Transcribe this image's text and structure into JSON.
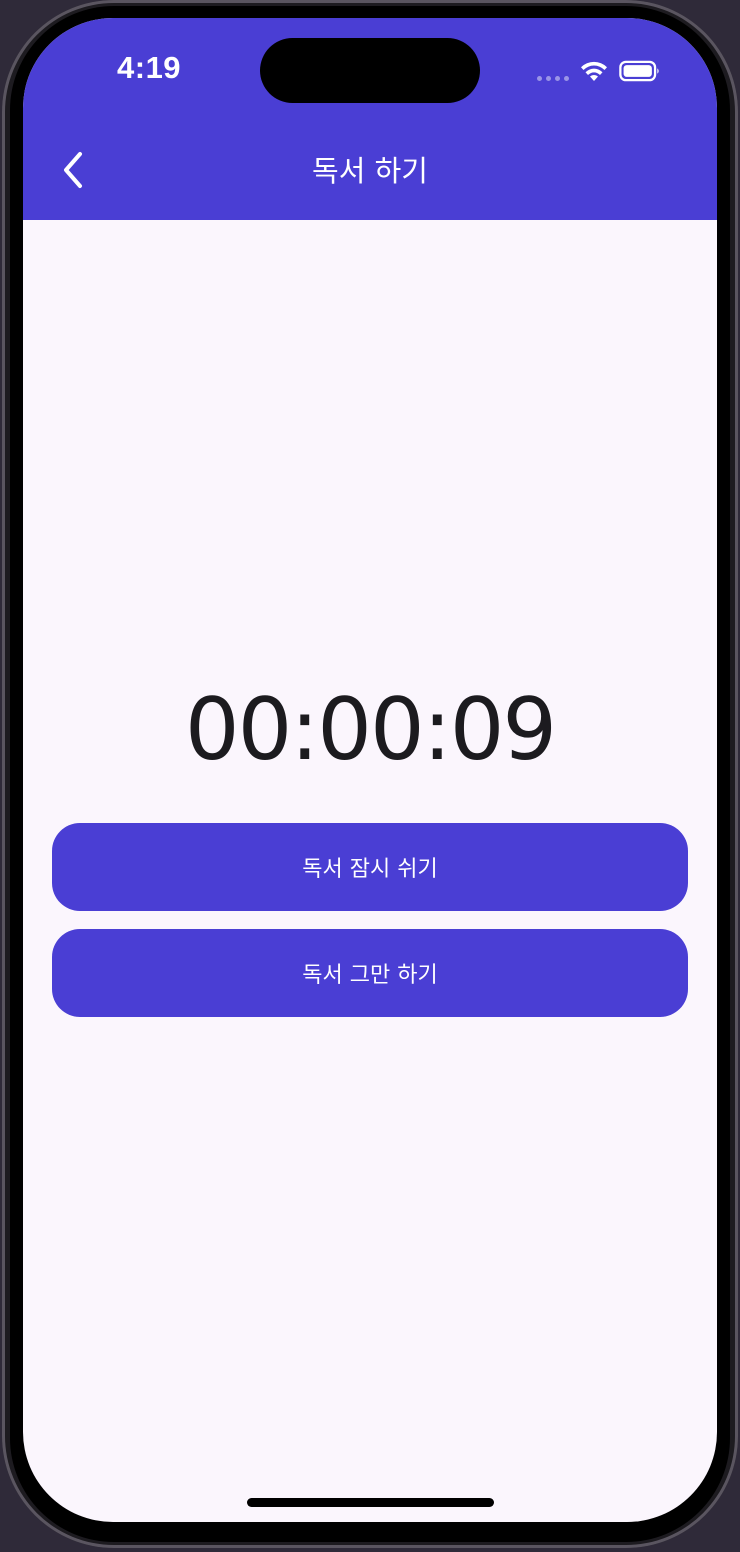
{
  "status_bar": {
    "time": "4:19"
  },
  "header": {
    "title": "독서 하기",
    "back_icon": "chevron-left-icon"
  },
  "timer": {
    "value": "00:00:09"
  },
  "actions": {
    "pause_label": "독서 잠시 쉬기",
    "stop_label": "독서 그만 하기"
  },
  "colors": {
    "primary": "#4a3ed4",
    "background": "#fbf6fd",
    "timer_text": "#1c1b1f"
  }
}
